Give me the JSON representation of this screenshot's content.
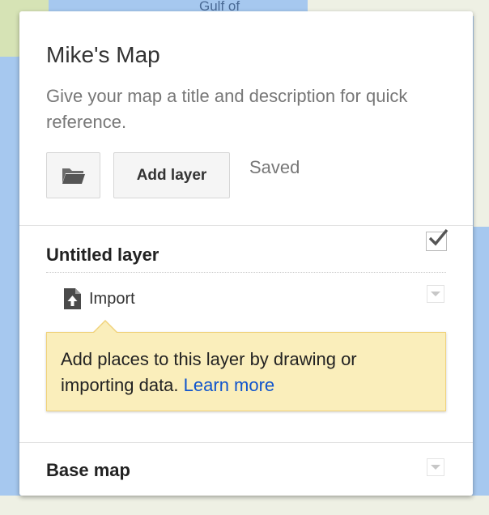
{
  "map": {
    "water_label": "Gulf of",
    "water_color": "#a6c8ef",
    "land_color": "#eef0e4"
  },
  "panel": {
    "title": "Mike's Map",
    "description": "Give your map a title and description for quick reference.",
    "open_button_icon": "folder-icon",
    "add_layer_label": "Add layer",
    "status": "Saved"
  },
  "layer": {
    "title": "Untitled layer",
    "visible": true,
    "import_icon": "file-upload-icon",
    "import_label": "Import",
    "tooltip_text": "Add places to this layer by drawing or importing data.",
    "tooltip_link": "Learn more",
    "link_color": "#1155cc",
    "tooltip_bg": "#faeebb"
  },
  "base_map": {
    "title": "Base map"
  }
}
